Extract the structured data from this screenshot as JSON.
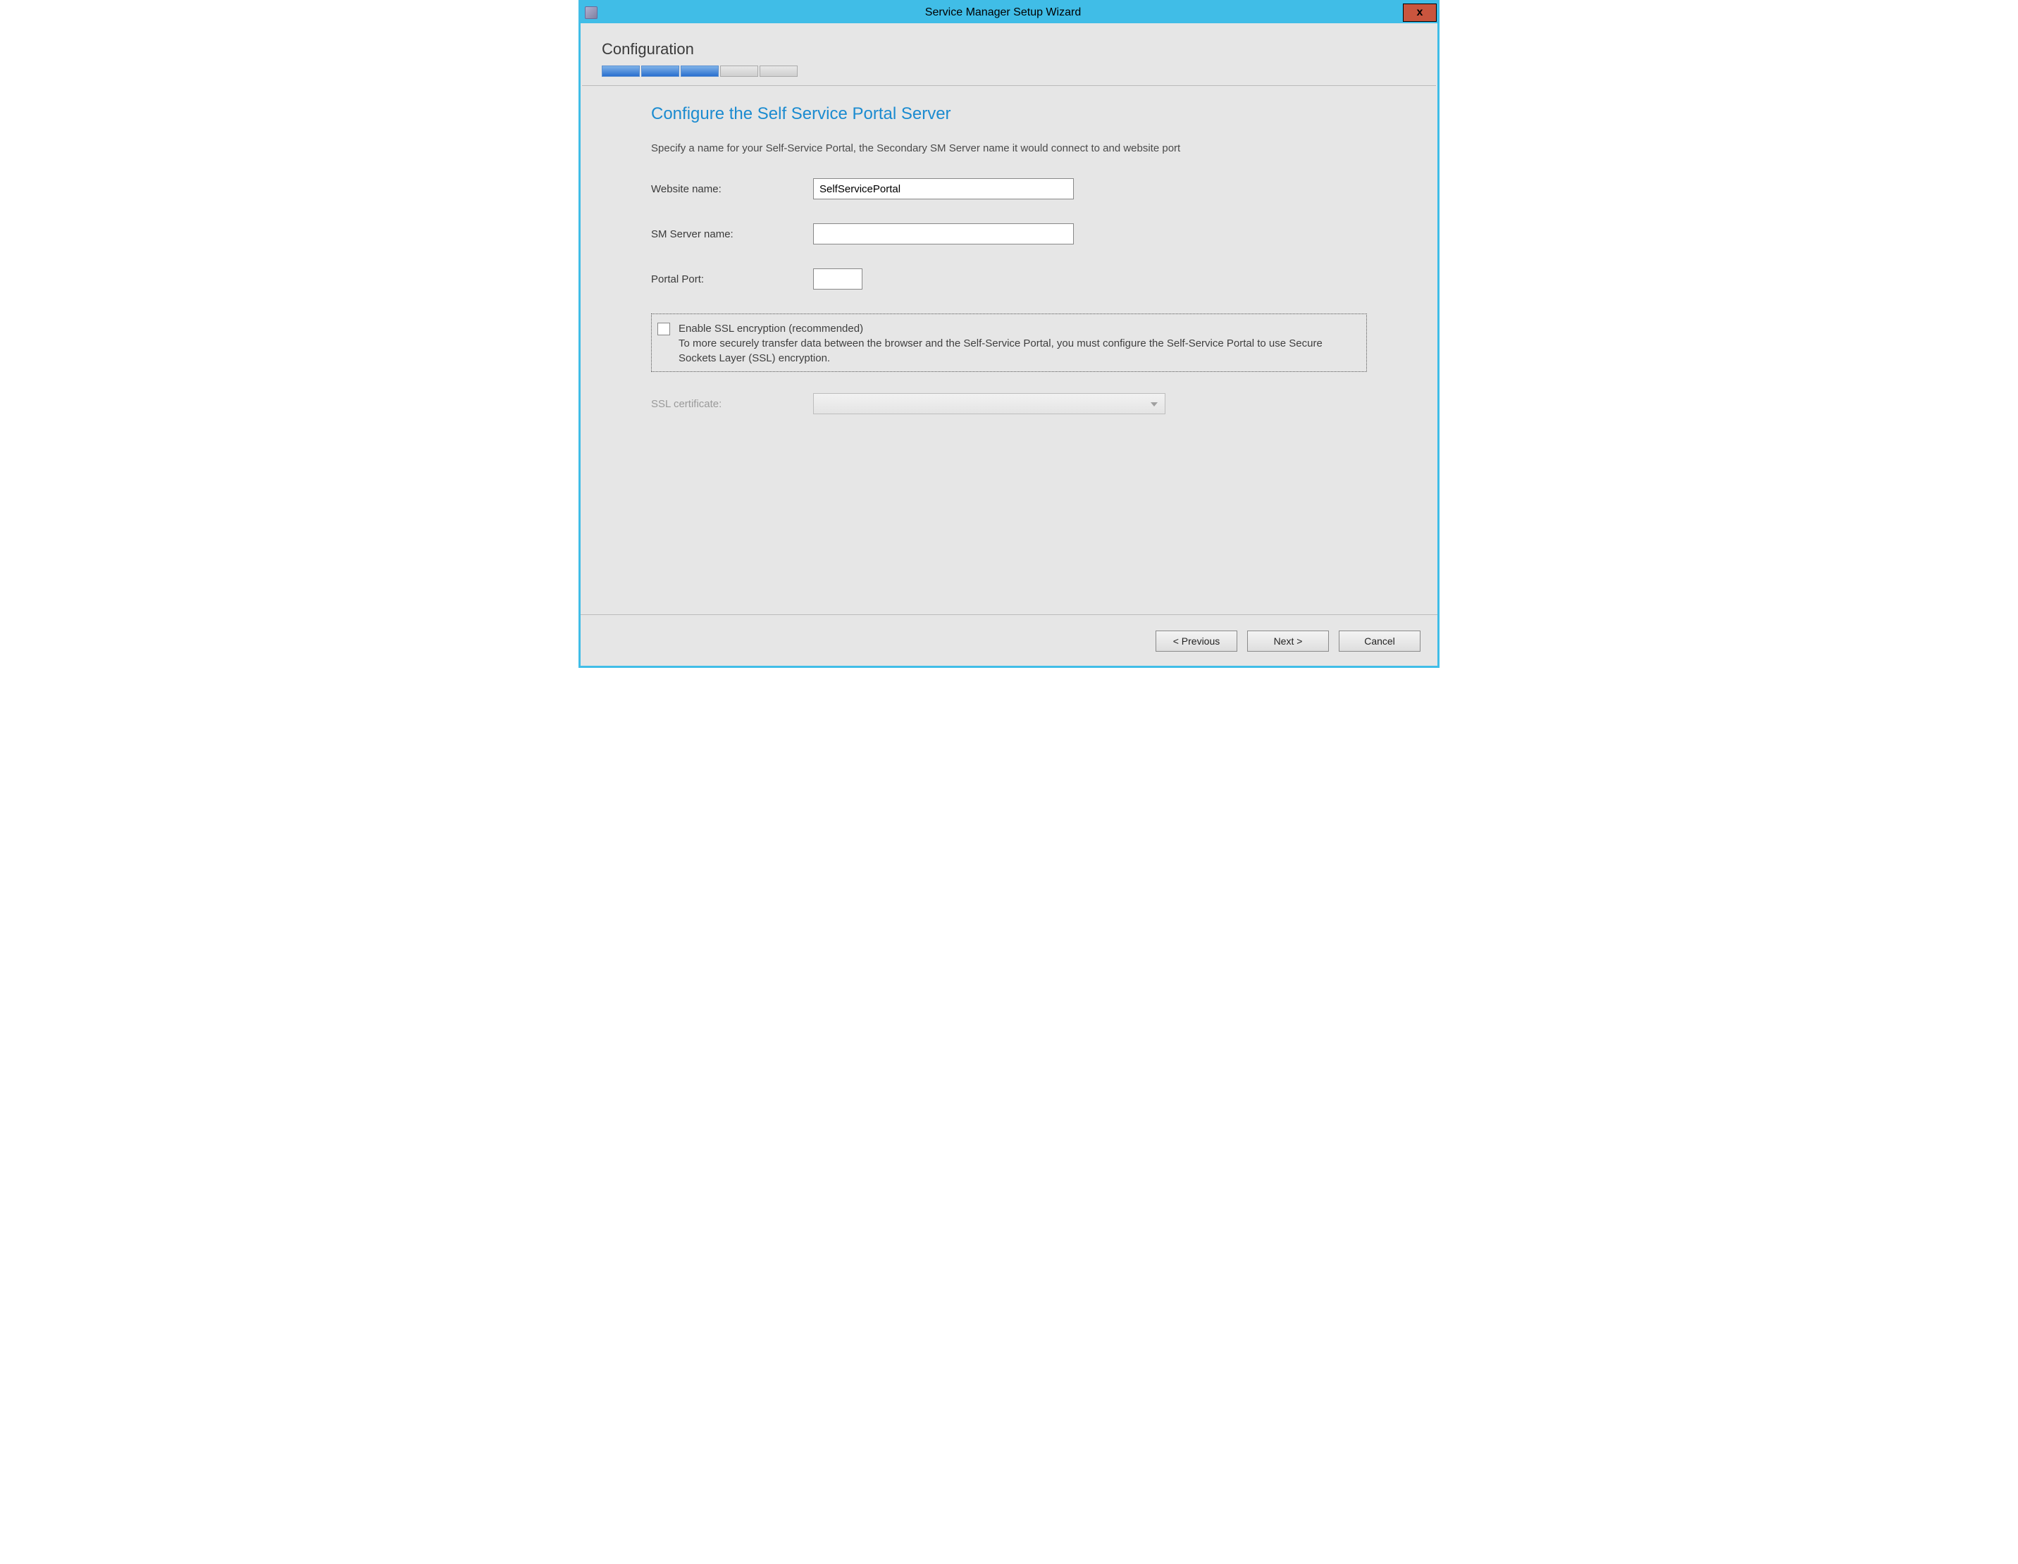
{
  "window": {
    "title": "Service Manager Setup Wizard",
    "close_glyph": "x"
  },
  "header": {
    "section_label": "Configuration",
    "progress_total": 5,
    "progress_filled": 3
  },
  "page": {
    "title": "Configure the Self Service Portal Server",
    "description": "Specify a name for your Self-Service Portal, the Secondary SM Server name it would connect to and website port"
  },
  "form": {
    "website_name": {
      "label": "Website name:",
      "value": "SelfServicePortal"
    },
    "sm_server_name": {
      "label": "SM Server name:",
      "value": ""
    },
    "portal_port": {
      "label": "Portal Port:",
      "value": ""
    },
    "ssl": {
      "checked": false,
      "title": "Enable SSL encryption (recommended)",
      "body": "To more securely transfer data between the browser and the Self-Service Portal, you must configure the Self-Service Portal to use Secure Sockets Layer (SSL) encryption."
    },
    "ssl_certificate": {
      "label": "SSL certificate:",
      "value": "",
      "enabled": false
    }
  },
  "footer": {
    "previous": "< Previous",
    "next": "Next >",
    "cancel": "Cancel"
  }
}
